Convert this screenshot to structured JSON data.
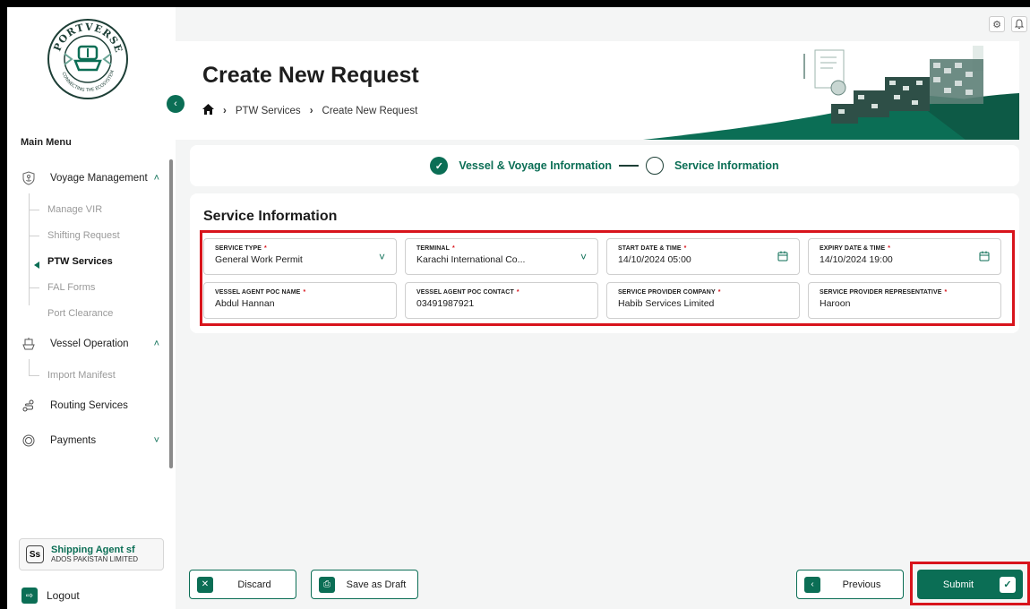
{
  "sidebar": {
    "logo_text": "PORTVERSE",
    "logo_tagline": "CONNECTING THE ECOSYSTEM",
    "menu_title": "Main Menu",
    "groups": [
      {
        "label": "Voyage Management",
        "icon": "anchor-badge-icon",
        "expanded": true
      },
      {
        "label": "Vessel Operation",
        "icon": "ship-icon",
        "expanded": true
      },
      {
        "label": "Routing Services",
        "icon": "route-icon"
      },
      {
        "label": "Payments",
        "icon": "coin-icon",
        "expanded": false
      }
    ],
    "voyage_sub": [
      "Manage VIR",
      "Shifting Request",
      "PTW Services",
      "FAL Forms",
      "Port Clearance"
    ],
    "vessel_sub": [
      "Import Manifest"
    ],
    "active_item": "PTW Services",
    "user": {
      "initials": "Ss",
      "name": "Shipping Agent sf",
      "org": "ADOS PAKISTAN LIMITED"
    },
    "logout_label": "Logout"
  },
  "header": {
    "title": "Create New Request",
    "breadcrumb": [
      "PTW Services",
      "Create New Request"
    ]
  },
  "stepper": {
    "steps": [
      {
        "label": "Vessel & Voyage Information",
        "status": "completed"
      },
      {
        "label": "Service Information",
        "status": "current"
      }
    ]
  },
  "service": {
    "title": "Service Information",
    "fields": [
      {
        "label": "SERVICE TYPE",
        "value": "General Work Permit",
        "type": "select"
      },
      {
        "label": "TERMINAL",
        "value": "Karachi International Co...",
        "type": "select"
      },
      {
        "label": "START DATE & TIME",
        "value": "14/10/2024 05:00",
        "type": "date"
      },
      {
        "label": "EXPIRY DATE & TIME",
        "value": "14/10/2024 19:00",
        "type": "date"
      },
      {
        "label": "VESSEL AGENT POC NAME",
        "value": "Abdul Hannan",
        "type": "text"
      },
      {
        "label": "VESSEL AGENT POC CONTACT",
        "value": "03491987921",
        "type": "text"
      },
      {
        "label": "SERVICE PROVIDER COMPANY",
        "value": "Habib Services Limited",
        "type": "text"
      },
      {
        "label": "SERVICE PROVIDER REPRESENTATIVE",
        "value": "Haroon",
        "type": "text"
      }
    ]
  },
  "footer": {
    "discard": "Discard",
    "save_draft": "Save as Draft",
    "previous": "Previous",
    "submit": "Submit"
  },
  "colors": {
    "brand": "#0b6e55",
    "highlight": "#d8141c"
  }
}
